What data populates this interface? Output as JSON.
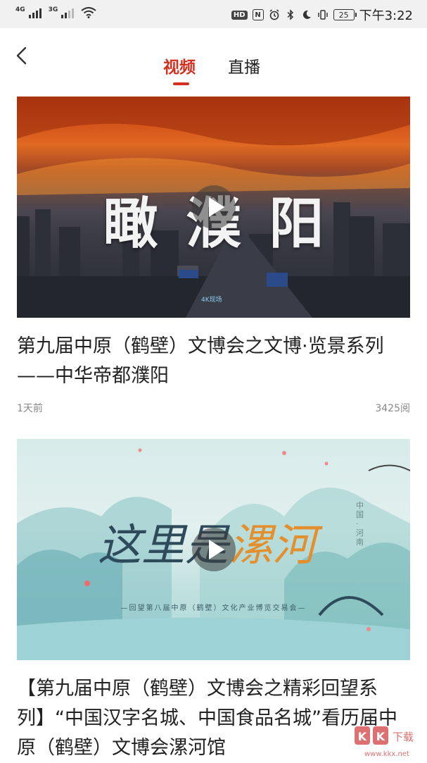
{
  "status_bar": {
    "network_1": "4G",
    "network_2": "3G",
    "hd_label": "HD",
    "nfc_label": "N",
    "battery": "25",
    "time": "下午3:22"
  },
  "nav": {
    "back_icon": "chevron-left-icon",
    "tabs": [
      {
        "label": "视频",
        "active": true
      },
      {
        "label": "直播",
        "active": false
      }
    ],
    "accent_color": "#d4301f"
  },
  "feed": [
    {
      "thumbnail_text": "瞰濮阳",
      "thumbnail_watermark": "4K现场",
      "title": "第九届中原（鹤壁）文博会之文博·览景系列——中华帝都濮阳",
      "time": "1天前",
      "views": "3425阅"
    },
    {
      "thumbnail_text_pre": "这里是",
      "thumbnail_text_accent": "漯河",
      "thumbnail_side_text": "中国·河南",
      "thumbnail_subtitle": "—回望第八届中原（鹤壁）文化产业博览交易会—",
      "title": "【第九届中原（鹤壁）文博会之精彩回望系列】“中国汉字名城、中国食品名城”看历届中原（鹤壁）文博会漯河馆"
    }
  ],
  "watermark": {
    "text": "KK下载",
    "url": "www.kkx.net"
  }
}
